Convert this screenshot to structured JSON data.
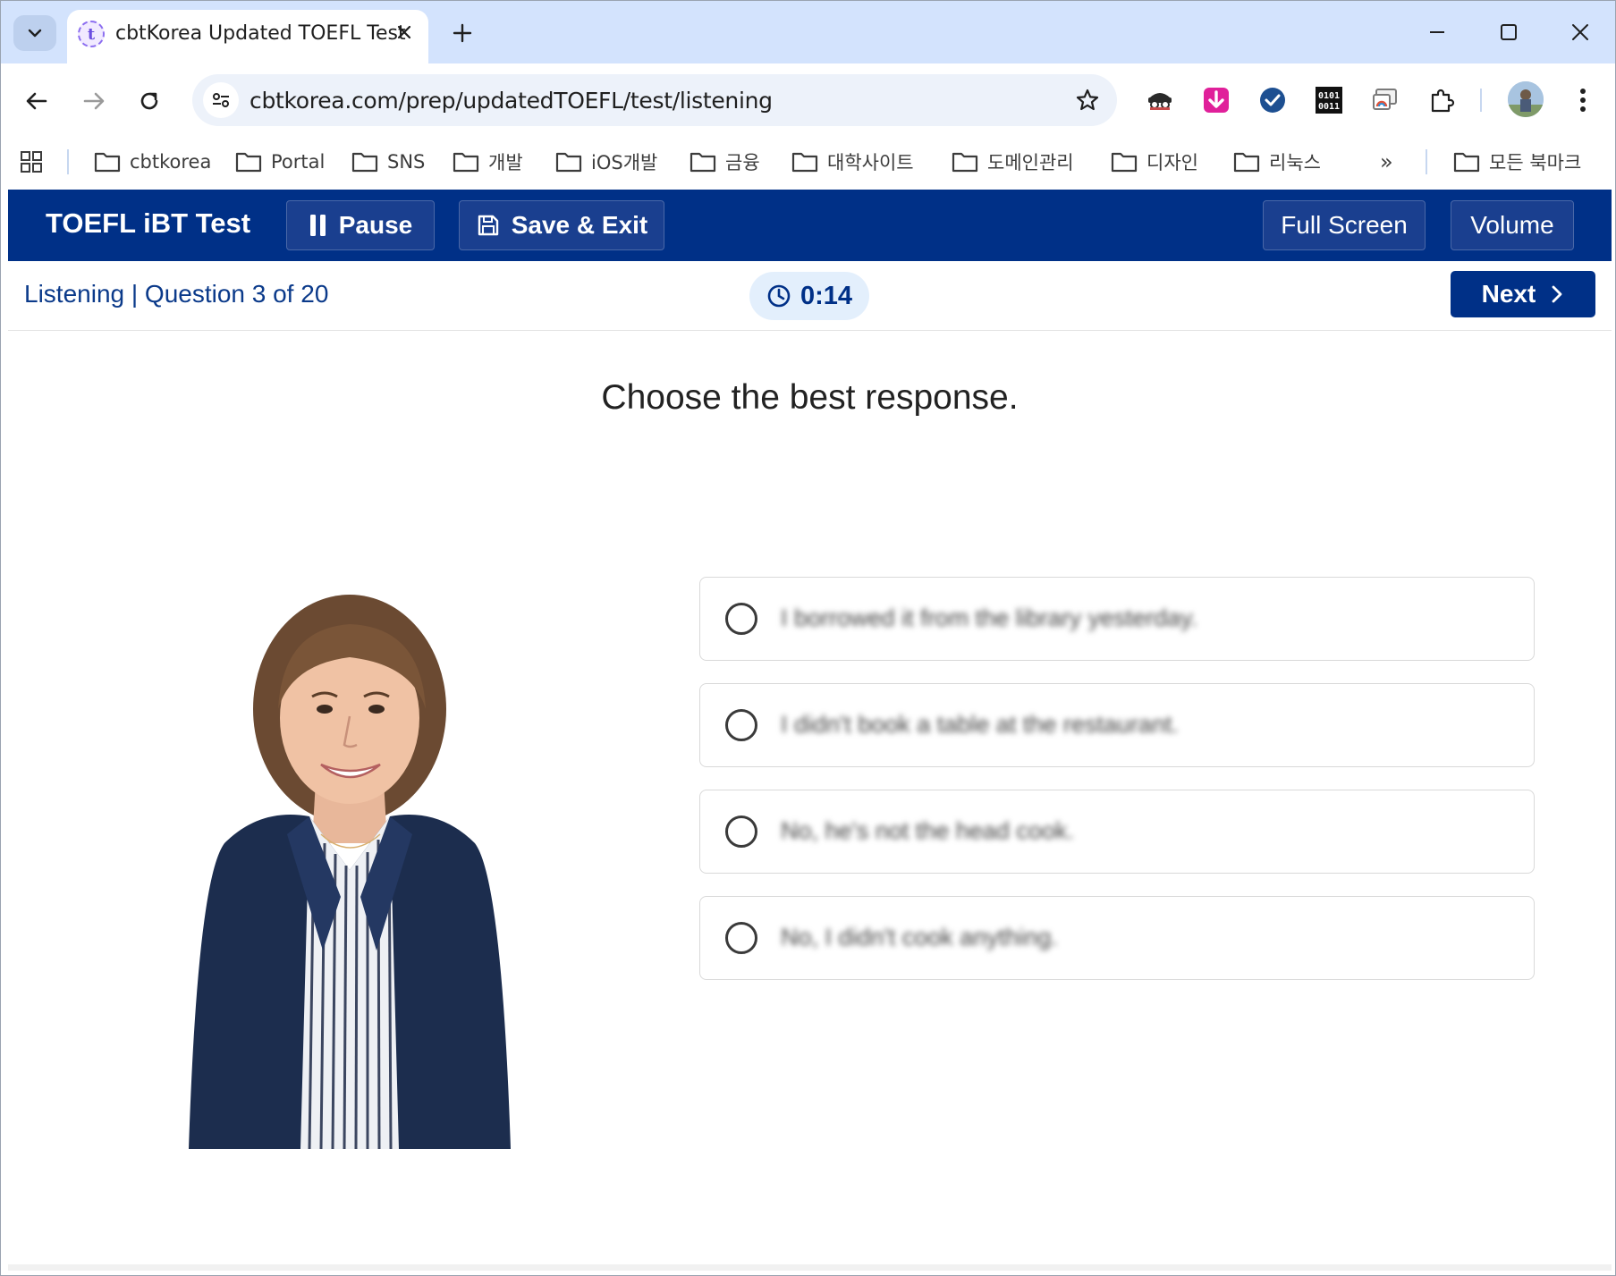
{
  "browser": {
    "tab": {
      "title": "cbtKorea Updated TOEFL Test",
      "favicon_letter": "t"
    },
    "address_bar": {
      "url": "cbtkorea.com/prep/updatedTOEFL/test/listening"
    },
    "bookmarks": [
      "cbtkorea",
      "Portal",
      "SNS",
      "개발",
      "iOS개발",
      "금융",
      "대학사이트",
      "도메인관리",
      "디자인",
      "리눅스"
    ],
    "bookmarks_overflow": "»",
    "all_bookmarks": "모든 북마크",
    "extensions": [
      "spy-extension-icon",
      "download-extension-icon",
      "check-extension-icon",
      "binary-extension-icon",
      "cast-extension-icon",
      "puzzle-extensions-icon"
    ],
    "ext_binary_text": "0101\n0011"
  },
  "app": {
    "title": "TOEFL iBT Test",
    "pause_label": "Pause",
    "save_exit_label": "Save & Exit",
    "fullscreen_label": "Full Screen",
    "volume_label": "Volume",
    "section_label": "Listening | Question 3 of 20",
    "timer": "0:14",
    "next_label": "Next",
    "accent_color": "#003087"
  },
  "question": {
    "prompt": "Choose the best response.",
    "options": [
      "I borrowed it from the library yesterday.",
      "I didn't book a table at the restaurant.",
      "No, he's not the head cook.",
      "No, I didn't cook anything."
    ]
  }
}
